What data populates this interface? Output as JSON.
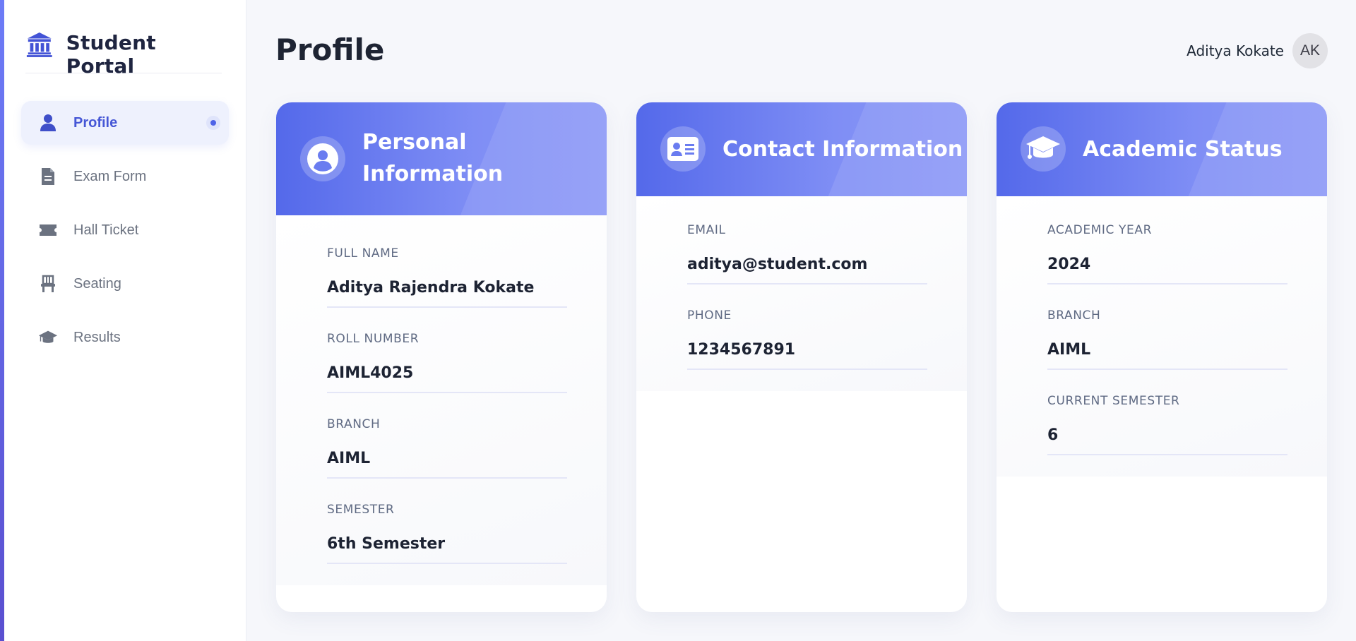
{
  "app": {
    "title": "Student Portal",
    "icon": "university-icon",
    "accent_color": "#4e63e8"
  },
  "sidebar": {
    "items": [
      {
        "label": "Profile",
        "icon": "user-icon",
        "active": true
      },
      {
        "label": "Exam Form",
        "icon": "document-icon",
        "active": false
      },
      {
        "label": "Hall Ticket",
        "icon": "ticket-icon",
        "active": false
      },
      {
        "label": "Seating",
        "icon": "chair-icon",
        "active": false
      },
      {
        "label": "Results",
        "icon": "graduation-cap-icon",
        "active": false
      }
    ]
  },
  "header": {
    "page_title": "Profile",
    "user_name": "Aditya Kokate",
    "avatar_initials": "AK"
  },
  "cards": {
    "personal": {
      "title": "Personal Information",
      "icon": "user-circle-icon",
      "fields": [
        {
          "label": "FULL NAME",
          "value": "Aditya Rajendra Kokate"
        },
        {
          "label": "ROLL NUMBER",
          "value": "AIML4025"
        },
        {
          "label": "BRANCH",
          "value": "AIML"
        },
        {
          "label": "SEMESTER",
          "value": "6th Semester"
        }
      ]
    },
    "contact": {
      "title": "Contact Information",
      "icon": "id-card-icon",
      "fields": [
        {
          "label": "EMAIL",
          "value": "aditya@student.com"
        },
        {
          "label": "PHONE",
          "value": "1234567891"
        }
      ]
    },
    "academic": {
      "title": "Academic Status",
      "icon": "graduation-cap-icon",
      "fields": [
        {
          "label": "ACADEMIC YEAR",
          "value": "2024"
        },
        {
          "label": "BRANCH",
          "value": "AIML"
        },
        {
          "label": "CURRENT SEMESTER",
          "value": "6"
        }
      ]
    }
  }
}
